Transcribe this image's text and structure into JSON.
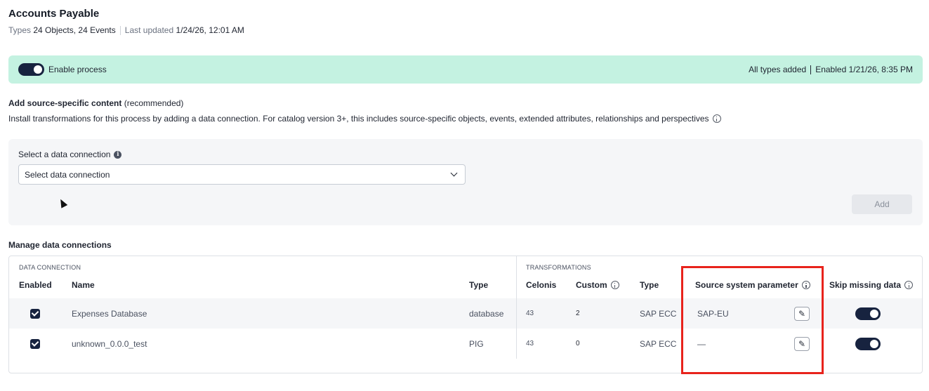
{
  "page": {
    "title": "Accounts Payable",
    "meta": {
      "types_label": "Types",
      "types_value": "24 Objects, 24 Events",
      "updated_label": "Last updated",
      "updated_value": "1/24/26, 12:01 AM"
    }
  },
  "banner": {
    "toggle_state": "on",
    "label": "Enable process",
    "status_left": "All types added",
    "status_right_label": "Enabled",
    "status_right_value": "1/21/26, 8:35 PM",
    "background": "#c4f2e1"
  },
  "source_content": {
    "title": "Add source-specific content",
    "title_suffix": "(recommended)",
    "description": "Install transformations for this process by adding a data connection. For catalog version 3+, this includes source-specific objects, events, extended attributes, relationships and perspectives"
  },
  "connection_panel": {
    "label": "Select a data connection",
    "select_value": "Select data connection",
    "add_button": "Add"
  },
  "manage": {
    "title": "Manage data connections",
    "group_data_connection": "DATA CONNECTION",
    "group_transformations": "TRANSFORMATIONS",
    "headers": {
      "enabled": "Enabled",
      "name": "Name",
      "type": "Type",
      "celonis": "Celonis",
      "custom": "Custom",
      "trans_type": "Type",
      "source_param": "Source system parameter",
      "skip_missing": "Skip missing data"
    },
    "rows": [
      {
        "enabled": true,
        "name": "Expenses Database",
        "type": "database",
        "celonis": "43",
        "custom": "2",
        "trans_type": "SAP ECC",
        "source_param": "SAP-EU",
        "skip_missing": true
      },
      {
        "enabled": true,
        "name": "unknown_0.0.0_test",
        "type": "PIG",
        "celonis": "43",
        "custom": "0",
        "trans_type": "SAP ECC",
        "source_param": "—",
        "skip_missing": true
      }
    ]
  },
  "colors": {
    "accent": "#17233f",
    "highlight": "#e8231c",
    "panel": "#f5f6f8"
  }
}
